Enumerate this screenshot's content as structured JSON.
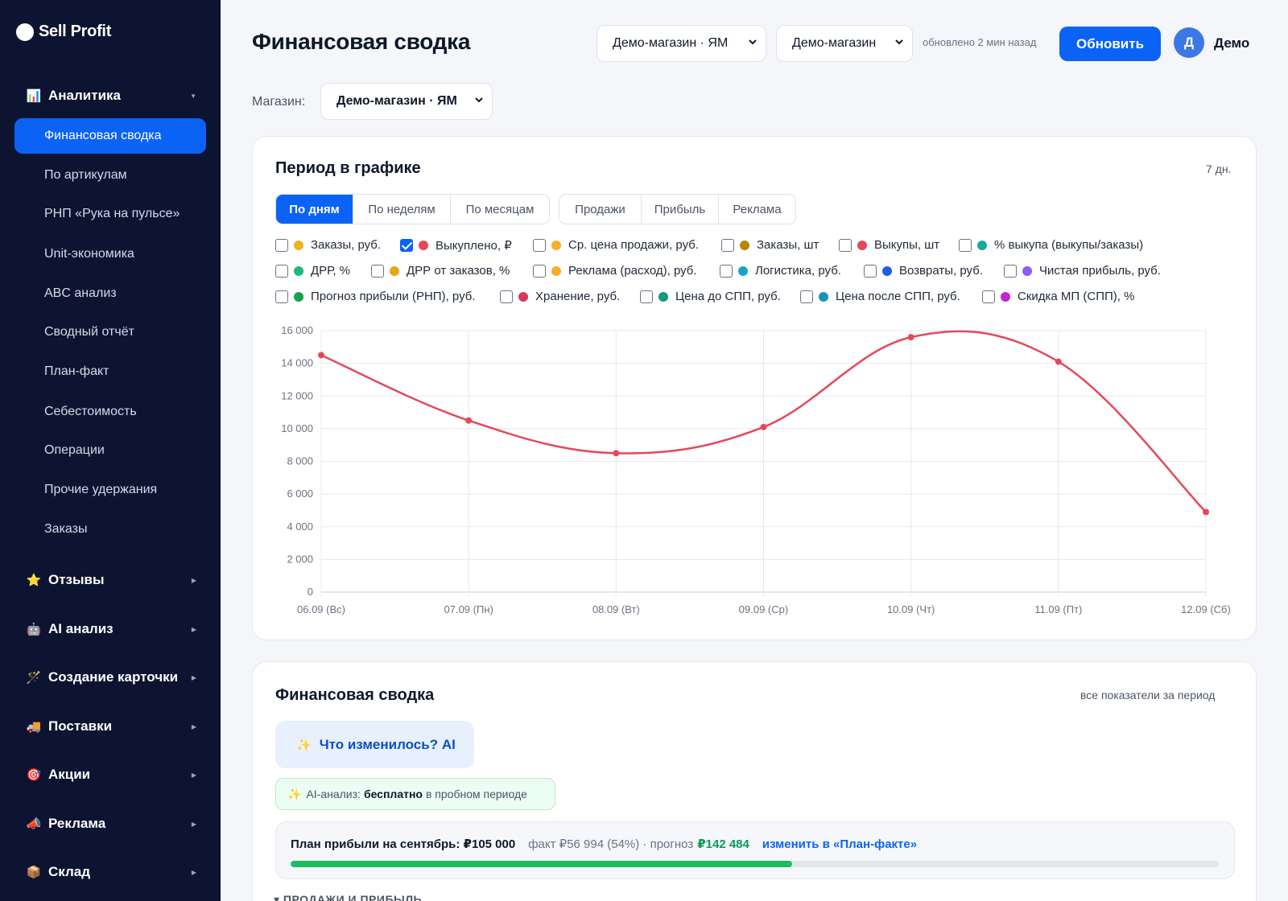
{
  "brand": {
    "name": "Sell Profit"
  },
  "sidebar": {
    "sections": [
      {
        "icon": "📊",
        "icon_name": "bar-chart-icon",
        "label": "Аналитика"
      },
      {
        "icon": "⭐",
        "icon_name": "star-icon",
        "label": "Отзывы"
      },
      {
        "icon": "🤖",
        "icon_name": "robot-icon",
        "label": "AI анализ"
      },
      {
        "icon": "🪄",
        "icon_name": "magic-wand-icon",
        "label": "Создание карточки"
      },
      {
        "icon": "🚚",
        "icon_name": "truck-icon",
        "label": "Поставки"
      },
      {
        "icon": "🎯",
        "icon_name": "target-icon",
        "label": "Акции"
      },
      {
        "icon": "📣",
        "icon_name": "megaphone-icon",
        "label": "Реклама"
      },
      {
        "icon": "📦",
        "icon_name": "box-icon",
        "label": "Склад"
      }
    ],
    "items": [
      {
        "label": "Финансовая сводка",
        "active": true
      },
      {
        "label": "По артикулам"
      },
      {
        "label": "РНП «Рука на пульсе»"
      },
      {
        "label": "Unit-экономика"
      },
      {
        "label": "ABC анализ"
      },
      {
        "label": "Сводный отчёт"
      },
      {
        "label": "План-факт"
      },
      {
        "label": "Себестоимость"
      },
      {
        "label": "Операции"
      },
      {
        "label": "Прочие удержания"
      },
      {
        "label": "Заказы"
      }
    ]
  },
  "header": {
    "title": "Финансовая сводка",
    "select_marketplace": "Демо-магазин · ЯМ",
    "select_store": "Демо-магазин",
    "updated": "обновлено 2 мин назад",
    "refresh_label": "Обновить",
    "avatar_letter": "Д",
    "user_name": "Демо"
  },
  "store_filter": {
    "label": "Магазин:",
    "value": "Демо-магазин · ЯМ"
  },
  "chart_card": {
    "title": "Период в графике",
    "period_note": "7 дн.",
    "granularity_tabs": [
      "По дням",
      "По неделям",
      "По месяцам"
    ],
    "active_granularity": 0,
    "preset_tabs": [
      "Продажи",
      "Прибыль",
      "Реклама"
    ],
    "metrics": [
      {
        "label": "Заказы, руб.",
        "color": "#f2b01e",
        "checked": false
      },
      {
        "label": "Выкуплено, ₽",
        "color": "#e5485a",
        "checked": true
      },
      {
        "label": "Ср. цена продажи, руб.",
        "color": "#f4ae2a",
        "checked": false
      },
      {
        "label": "Заказы, шт",
        "color": "#b8860b",
        "checked": false
      },
      {
        "label": "Выкупы, шт",
        "color": "#e5485a",
        "checked": false
      },
      {
        "label": "% выкупа (выкупы/заказы)",
        "color": "#17a7a0",
        "checked": false
      },
      {
        "label": "ДРР, %",
        "color": "#1fba7a",
        "checked": false
      },
      {
        "label": "ДРР от заказов, %",
        "color": "#e6a817",
        "checked": false
      },
      {
        "label": "Реклама (расход), руб.",
        "color": "#f4ae2a",
        "checked": false
      },
      {
        "label": "Логистика, руб.",
        "color": "#19a7c4",
        "checked": false
      },
      {
        "label": "Возвраты, руб.",
        "color": "#1f5fe8",
        "checked": false
      },
      {
        "label": "Чистая прибыль, руб.",
        "color": "#8b5cf6",
        "checked": false
      },
      {
        "label": "Прогноз прибыли (РНП), руб.",
        "color": "#16a34a",
        "checked": false
      },
      {
        "label": "Хранение, руб.",
        "color": "#d63a5e",
        "checked": false
      },
      {
        "label": "Цена до СПП, руб.",
        "color": "#0e9b7c",
        "checked": false
      },
      {
        "label": "Цена после СПП, руб.",
        "color": "#1596b6",
        "checked": false
      },
      {
        "label": "Скидка МП (СПП), %",
        "color": "#c026d3",
        "checked": false
      }
    ]
  },
  "chart_data": {
    "type": "line",
    "x": [
      "06.09 (Вс)",
      "07.09 (Пн)",
      "08.09 (Вт)",
      "09.09 (Ср)",
      "10.09 (Чт)",
      "11.09 (Пт)",
      "12.09 (Сб)"
    ],
    "series": [
      {
        "name": "Выкуплено, ₽",
        "color": "#e5485a",
        "values": [
          14500,
          10500,
          8500,
          10100,
          15600,
          14100,
          4900
        ]
      }
    ],
    "ylim": [
      0,
      16000
    ],
    "yticks": [
      "0",
      "2 000",
      "4 000",
      "6 000",
      "8 000",
      "10 000",
      "12 000",
      "14 000",
      "16 000"
    ],
    "grid": true
  },
  "summary_card": {
    "title": "Финансовая сводка",
    "note": "все показатели за период",
    "ai_button": "Что изменилось? AI",
    "ai_free_prefix": "AI-анализ:",
    "ai_free_bold": "бесплатно",
    "ai_free_suffix": "в пробном периоде",
    "plan_title": "План прибыли на сентябрь: ₽105 000",
    "plan_fact": "факт ₽56 994 (54%) · прогноз",
    "plan_forecast": "₽142 484",
    "plan_link": "изменить в «План-факте»",
    "plan_progress": 0.54,
    "next_section": "ПРОДАЖИ И ПРИБЫЛЬ"
  }
}
